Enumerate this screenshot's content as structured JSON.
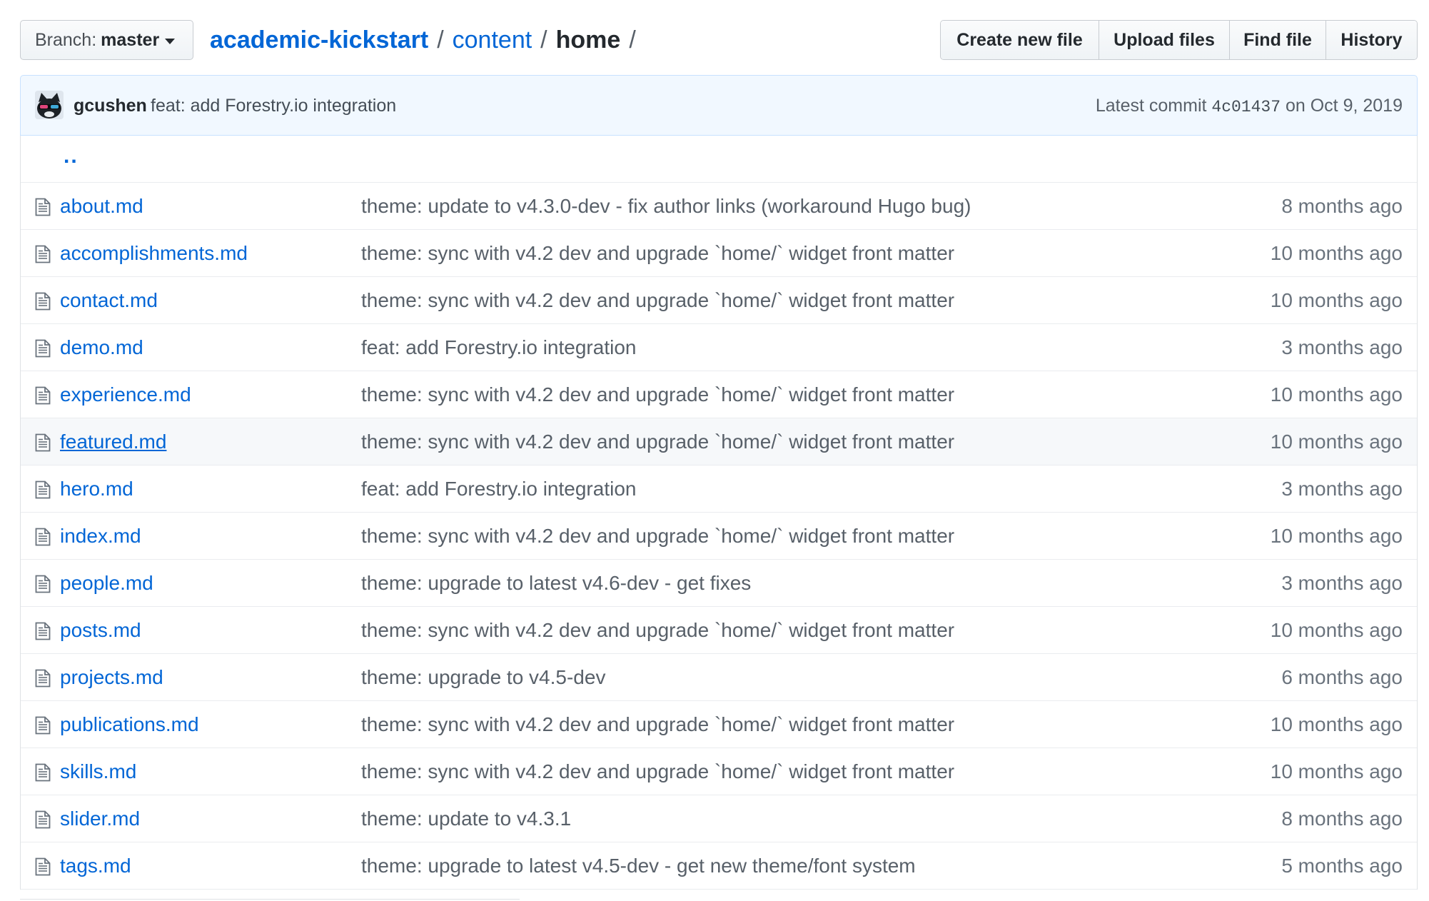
{
  "branch": {
    "label": "Branch:",
    "value": "master"
  },
  "breadcrumb": {
    "repo": "academic-kickstart",
    "sep1": "/",
    "folder": "content",
    "sep2": "/",
    "current": "home",
    "sep3": "/"
  },
  "actions": {
    "create": "Create new file",
    "upload": "Upload files",
    "find": "Find file",
    "history": "History"
  },
  "commit": {
    "author": "gcushen",
    "message": "feat: add Forestry.io integration",
    "prefix": "Latest commit",
    "sha": "4c01437",
    "on": "on Oct 9, 2019"
  },
  "parent_link": "..",
  "files": [
    {
      "name": "about.md",
      "message": "theme: update to v4.3.0-dev - fix author links (workaround Hugo bug)",
      "age": "8 months ago"
    },
    {
      "name": "accomplishments.md",
      "message": "theme: sync with v4.2 dev and upgrade `home/` widget front matter",
      "age": "10 months ago"
    },
    {
      "name": "contact.md",
      "message": "theme: sync with v4.2 dev and upgrade `home/` widget front matter",
      "age": "10 months ago"
    },
    {
      "name": "demo.md",
      "message": "feat: add Forestry.io integration",
      "age": "3 months ago"
    },
    {
      "name": "experience.md",
      "message": "theme: sync with v4.2 dev and upgrade `home/` widget front matter",
      "age": "10 months ago"
    },
    {
      "name": "featured.md",
      "message": "theme: sync with v4.2 dev and upgrade `home/` widget front matter",
      "age": "10 months ago",
      "hover": true
    },
    {
      "name": "hero.md",
      "message": "feat: add Forestry.io integration",
      "age": "3 months ago"
    },
    {
      "name": "index.md",
      "message": "theme: sync with v4.2 dev and upgrade `home/` widget front matter",
      "age": "10 months ago"
    },
    {
      "name": "people.md",
      "message": "theme: upgrade to latest v4.6-dev - get fixes",
      "age": "3 months ago"
    },
    {
      "name": "posts.md",
      "message": "theme: sync with v4.2 dev and upgrade `home/` widget front matter",
      "age": "10 months ago"
    },
    {
      "name": "projects.md",
      "message": "theme: upgrade to v4.5-dev",
      "age": "6 months ago"
    },
    {
      "name": "publications.md",
      "message": "theme: sync with v4.2 dev and upgrade `home/` widget front matter",
      "age": "10 months ago"
    },
    {
      "name": "skills.md",
      "message": "theme: sync with v4.2 dev and upgrade `home/` widget front matter",
      "age": "10 months ago"
    },
    {
      "name": "slider.md",
      "message": "theme: update to v4.3.1",
      "age": "8 months ago"
    },
    {
      "name": "tags.md",
      "message": "theme: upgrade to latest v4.5-dev - get new theme/font system",
      "age": "5 months ago"
    }
  ],
  "colors": {
    "link": "#0366d6",
    "commit_bar_bg": "#f1f8ff",
    "hover_row_bg": "#f6f8fa"
  }
}
